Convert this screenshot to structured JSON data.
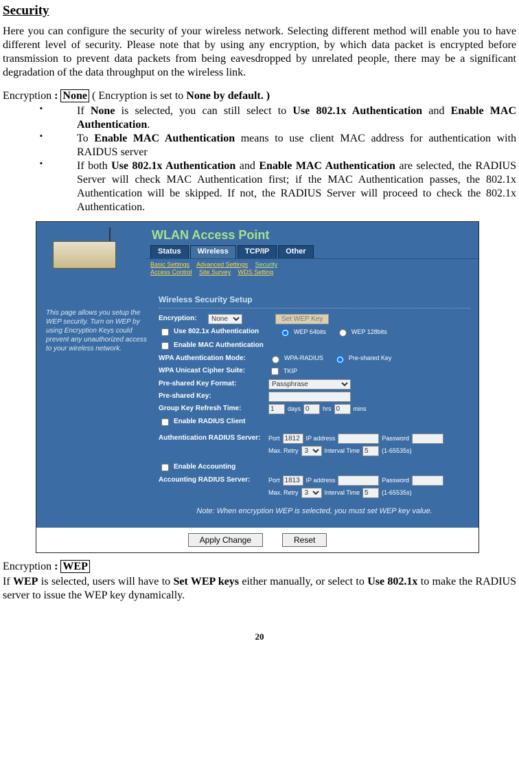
{
  "page": {
    "title": "Security",
    "intro": "Here you can configure the security of your wireless network. Selecting different method will enable you to have different level of security.  Please note that by using any encryption, by which data packet is encrypted before transmission to prevent data packets from being eavesdropped by unrelated people, there may be a significant degradation of the data throughput on the wireless link.",
    "enc_line_prefix": "Encryption ",
    "enc_colon": ": ",
    "enc_none_box": "None",
    "enc_none_suffix": " ( Encryption is set to ",
    "enc_none_bold": "None",
    "enc_none_tail": " by default. )",
    "bullets": [
      {
        "pre": "If ",
        "b1": "None",
        "mid": " is selected, you can still select to ",
        "b2": "Use 802.1x Authentication",
        "mid2": " and ",
        "b3": "Enable MAC Authentication",
        "tail": "."
      },
      {
        "pre": "To ",
        "b1": "Enable MAC Authentication",
        "mid": " means to use client MAC address for authentication with RAIDUS server",
        "b2": "",
        "mid2": "",
        "b3": "",
        "tail": ""
      },
      {
        "pre": "If both ",
        "b1": "Use 802.1x Authentication",
        "mid": " and ",
        "b2": "Enable MAC Authentication",
        "mid2": " are selected, the RADIUS Server will check MAC Authentication first; if the MAC Authentication passes, the 802.1x Authentication will be skipped. If not, the RADIUS Server will proceed to check the 802.1x Authentication.",
        "b3": "",
        "tail": ""
      }
    ],
    "enc_wep_box": "WEP",
    "wep_para_pre": "If ",
    "wep_para_b1": "WEP",
    "wep_para_mid": " is selected, users will have to ",
    "wep_para_b2": "Set WEP keys",
    "wep_para_mid2": " either manually, or select to ",
    "wep_para_b3": "Use 802.1x",
    "wep_para_tail": " to make the RADIUS server to issue the WEP key dynamically.",
    "pagenum": "20"
  },
  "ui": {
    "banner": "WLAN Access Point",
    "tabs": [
      "Status",
      "Wireless",
      "TCP/IP",
      "Other"
    ],
    "subtabs_row1": [
      "Basic Settings",
      "Advanced Settings",
      "Security"
    ],
    "subtabs_row2": [
      "Access Control",
      "Site Survey",
      "WDS Setting"
    ],
    "sidetext": "This page allows you setup the WEP security. Turn on WEP by using Encryption Keys could prevent any unauthorized access to your wireless network.",
    "section": "Wireless Security Setup",
    "labels": {
      "encryption": "Encryption:",
      "setwep": "Set WEP Key",
      "use8021x": "Use 802.1x Authentication",
      "wep64": "WEP 64bits",
      "wep128": "WEP 128bits",
      "enablemac": "Enable MAC Authentication",
      "wpamode": "WPA Authentication Mode:",
      "wparadius": "WPA-RADIUS",
      "psk": "Pre-shared Key",
      "cipher": "WPA Unicast Cipher Suite:",
      "tkip": "TKIP",
      "pskformat": "Pre-shared Key Format:",
      "prekey": "Pre-shared Key:",
      "grouptime": "Group Key Refresh Time:",
      "days": "days",
      "hrs": "hrs",
      "mins": "mins",
      "enableradius": "Enable RADIUS Client",
      "authserver": "Authentication RADIUS Server:",
      "port": "Port",
      "ip": "IP address",
      "pwd": "Password",
      "maxretry": "Max. Retry",
      "interval": "Interval Time",
      "range": "(1-65535s)",
      "enableacct": "Enable Accounting",
      "acctserver": "Accounting RADIUS Server:",
      "note": "Note: When encryption WEP is selected, you must set WEP key value.",
      "apply": "Apply Change",
      "reset": "Reset"
    },
    "values": {
      "enc_select": "None",
      "psk_format": "Passphrase",
      "grp_days": "1",
      "grp_hrs": "0",
      "grp_mins": "0",
      "auth_port": "1812",
      "auth_retry": "3",
      "auth_interval": "5",
      "acct_port": "1813",
      "acct_retry": "3",
      "acct_interval": "5"
    }
  }
}
